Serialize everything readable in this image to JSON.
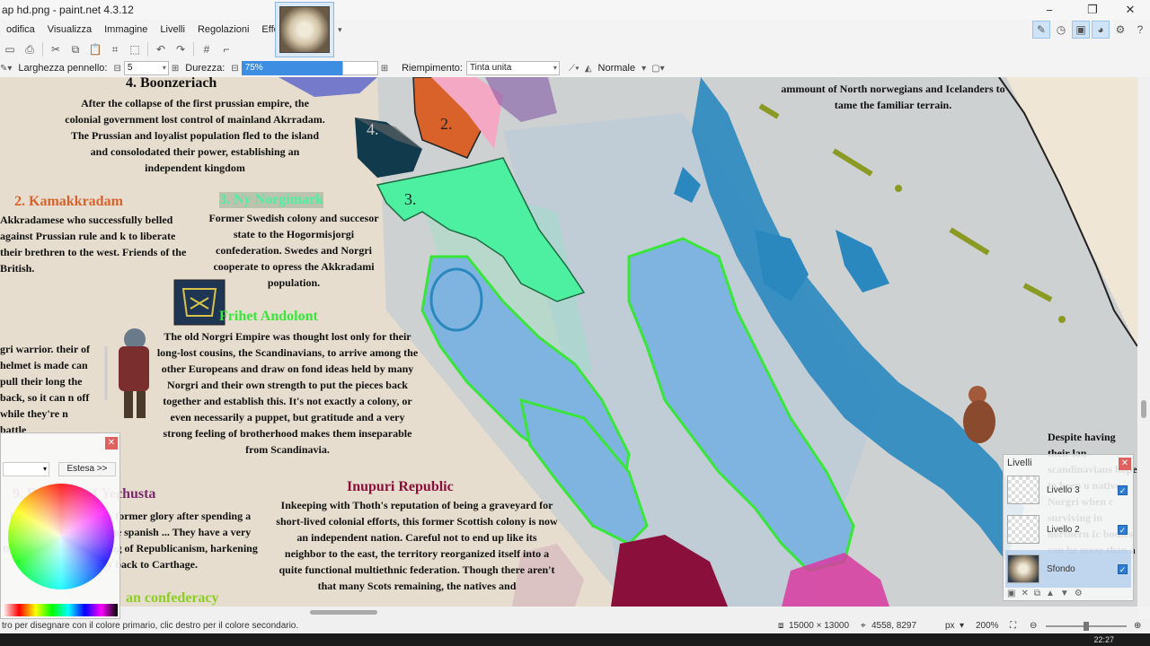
{
  "window": {
    "title": "ap hd.png - paint.net 4.3.12",
    "minimize_glyph": "−",
    "restore_glyph": "❐",
    "close_glyph": "✕"
  },
  "menu": {
    "items": [
      "odifica",
      "Visualizza",
      "Immagine",
      "Livelli",
      "Regolazioni",
      "Effetti"
    ]
  },
  "toolbar": {
    "brush_width_label": "Larghezza pennello:",
    "brush_width_value": "5",
    "hardness_label": "Durezza:",
    "hardness_value": "75%",
    "fill_label": "Riempimento:",
    "fill_value": "Tinta unita",
    "blend_mode": "Normale"
  },
  "map": {
    "texts": {
      "boonzeriach_title": "4. Boonzeriach",
      "boonzeriach_body": "After the collapse of the first prussian empire, the colonial government lost control of mainland Akrradam. The Prussian and loyalist population fled to the island and consolodated their power, establishing an independent kingdom",
      "kamakkradam_title": "2. Kamakkradam",
      "kamakkradam_body": "Akkradamese who successfully belled against Prussian rule and k to liberate their brethren to the west. Friends of the British.",
      "ny_norgimark_title": "3. Ny Norgimark",
      "ny_norgimark_body": "Former Swedish colony and succesor state to the Hogormisjorgi confederation. Swedes and Norgri cooperate to opress the Akkradami population.",
      "frihet_title": "Frihet Andolont",
      "frihet_body": "The old Norgri Empire was thought lost only for their long-lost cousins, the Scandinavians, to arrive among the other Europeans and draw on fond ideas held by many Norgri and their own strength to put the pieces back together and establish this. It's not exactly a colony, or even necessarily a puppet, but gratitude and a very strong feeling of brotherhood makes them inseparable from Scandinavia.",
      "warrior_note": "gri warrior. their of helmet is made can pull their long the back, so it can n off while they're n battle",
      "yechusta_title": "9. Republic of Yechusta",
      "yechusta_body": "Proudly restored to its former glory after spending a period of time under the spanish ... They have a very traditional understanding of Republicanism, harkening all the way back to Carthage.",
      "confederacy_title": "an confederacy",
      "inupuri_title": "Inupuri Republic",
      "inupuri_body": "Inkeeping with Thoth's reputation of being a graveyard for short-lived colonial efforts, this former Scottish colony is now an independent nation. Careful not to end up like its neighbor to the east, the territory reorganized itself into a quite functional multiethnic federation. Though there aren't that many Scots remaining, the natives and",
      "norwegians_body": "ammount of North norwegians and Icelanders to tame the familiar terrain.",
      "despite_body": "Despite having their lan scandinavians hope to keep u native Norgri when c surviving in northern Ic bodies can be more than a",
      "label_2": "2.",
      "label_3": "3.",
      "label_4": "4."
    },
    "colors": {
      "parchment": "#e6ddcf",
      "sea": "#c9cfd2",
      "island_blue": "#7fb3e0",
      "outline_green": "#39e63a",
      "mint": "#4cf0a0",
      "orange": "#d9622b",
      "pink": "#f4a8c4",
      "dark_teal": "#123a4d",
      "mountain_blue": "#2a88bf",
      "crimson": "#8a0f3a",
      "magenta": "#d83aa0"
    }
  },
  "palette": {
    "dropdown": "",
    "extend_button": "Estesa >>"
  },
  "layers": {
    "title": "Livelli",
    "items": [
      {
        "name": "Livello 3",
        "checked": true
      },
      {
        "name": "Livello 2",
        "checked": true
      },
      {
        "name": "Sfondo",
        "checked": true
      }
    ]
  },
  "status": {
    "hint": "tro per disegnare con il colore primario, clic destro per il colore secondario.",
    "image_size": "15000 × 13000",
    "cursor_pos": "4558, 8297",
    "units": "px",
    "zoom": "200%"
  },
  "taskbar": {
    "clock": "22:27"
  }
}
